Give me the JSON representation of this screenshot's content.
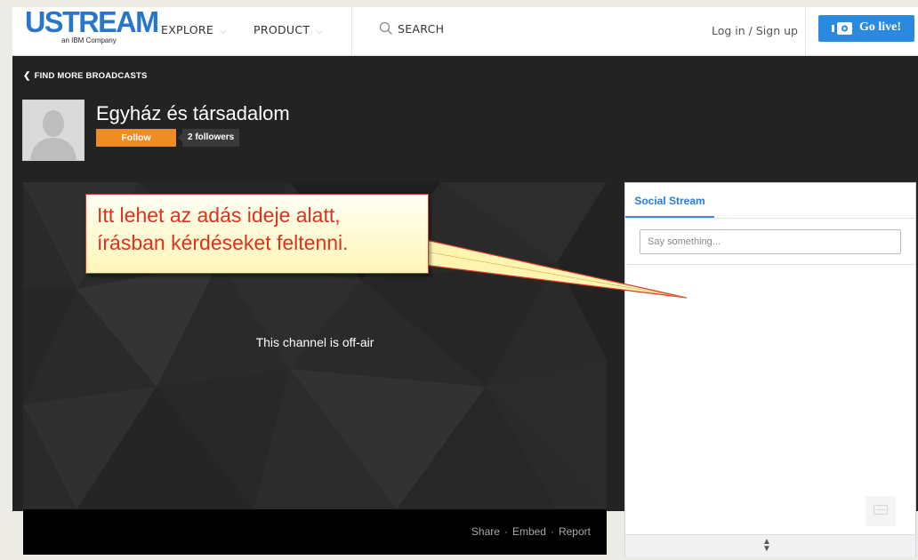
{
  "header": {
    "logo_text": "USTREAM",
    "logo_subtitle": "an IBM Company",
    "nav": [
      {
        "label": "EXPLORE"
      },
      {
        "label": "PRODUCT"
      }
    ],
    "search_label": "SEARCH",
    "login_label": "Log in / Sign up",
    "golive_label": "Go live!"
  },
  "channel": {
    "back_label": "FIND MORE BROADCASTS",
    "title": "Egyház és társadalom",
    "follow_label": "Follow",
    "followers_label": "2 followers"
  },
  "player": {
    "status_text": "This channel is off-air",
    "links": {
      "share": "Share",
      "embed": "Embed",
      "report": "Report",
      "separator": "·"
    }
  },
  "social": {
    "tab_label": "Social Stream",
    "input_placeholder": "Say something..."
  },
  "annotation": {
    "line1": "Itt lehet az adás ideje alatt,",
    "line2": "írásban kérdéseket feltenni."
  },
  "colors": {
    "brand_blue": "#2876c9",
    "golive_blue": "#2a8ae0",
    "follow_orange": "#f08c24",
    "channel_bg": "#232323",
    "callout_text": "#e0301e"
  },
  "icons": {
    "search": "search-icon",
    "live": "broadcast-camera-icon",
    "back": "chevron-left-icon",
    "message": "message-icon",
    "resize": "resize-arrows-icon"
  }
}
